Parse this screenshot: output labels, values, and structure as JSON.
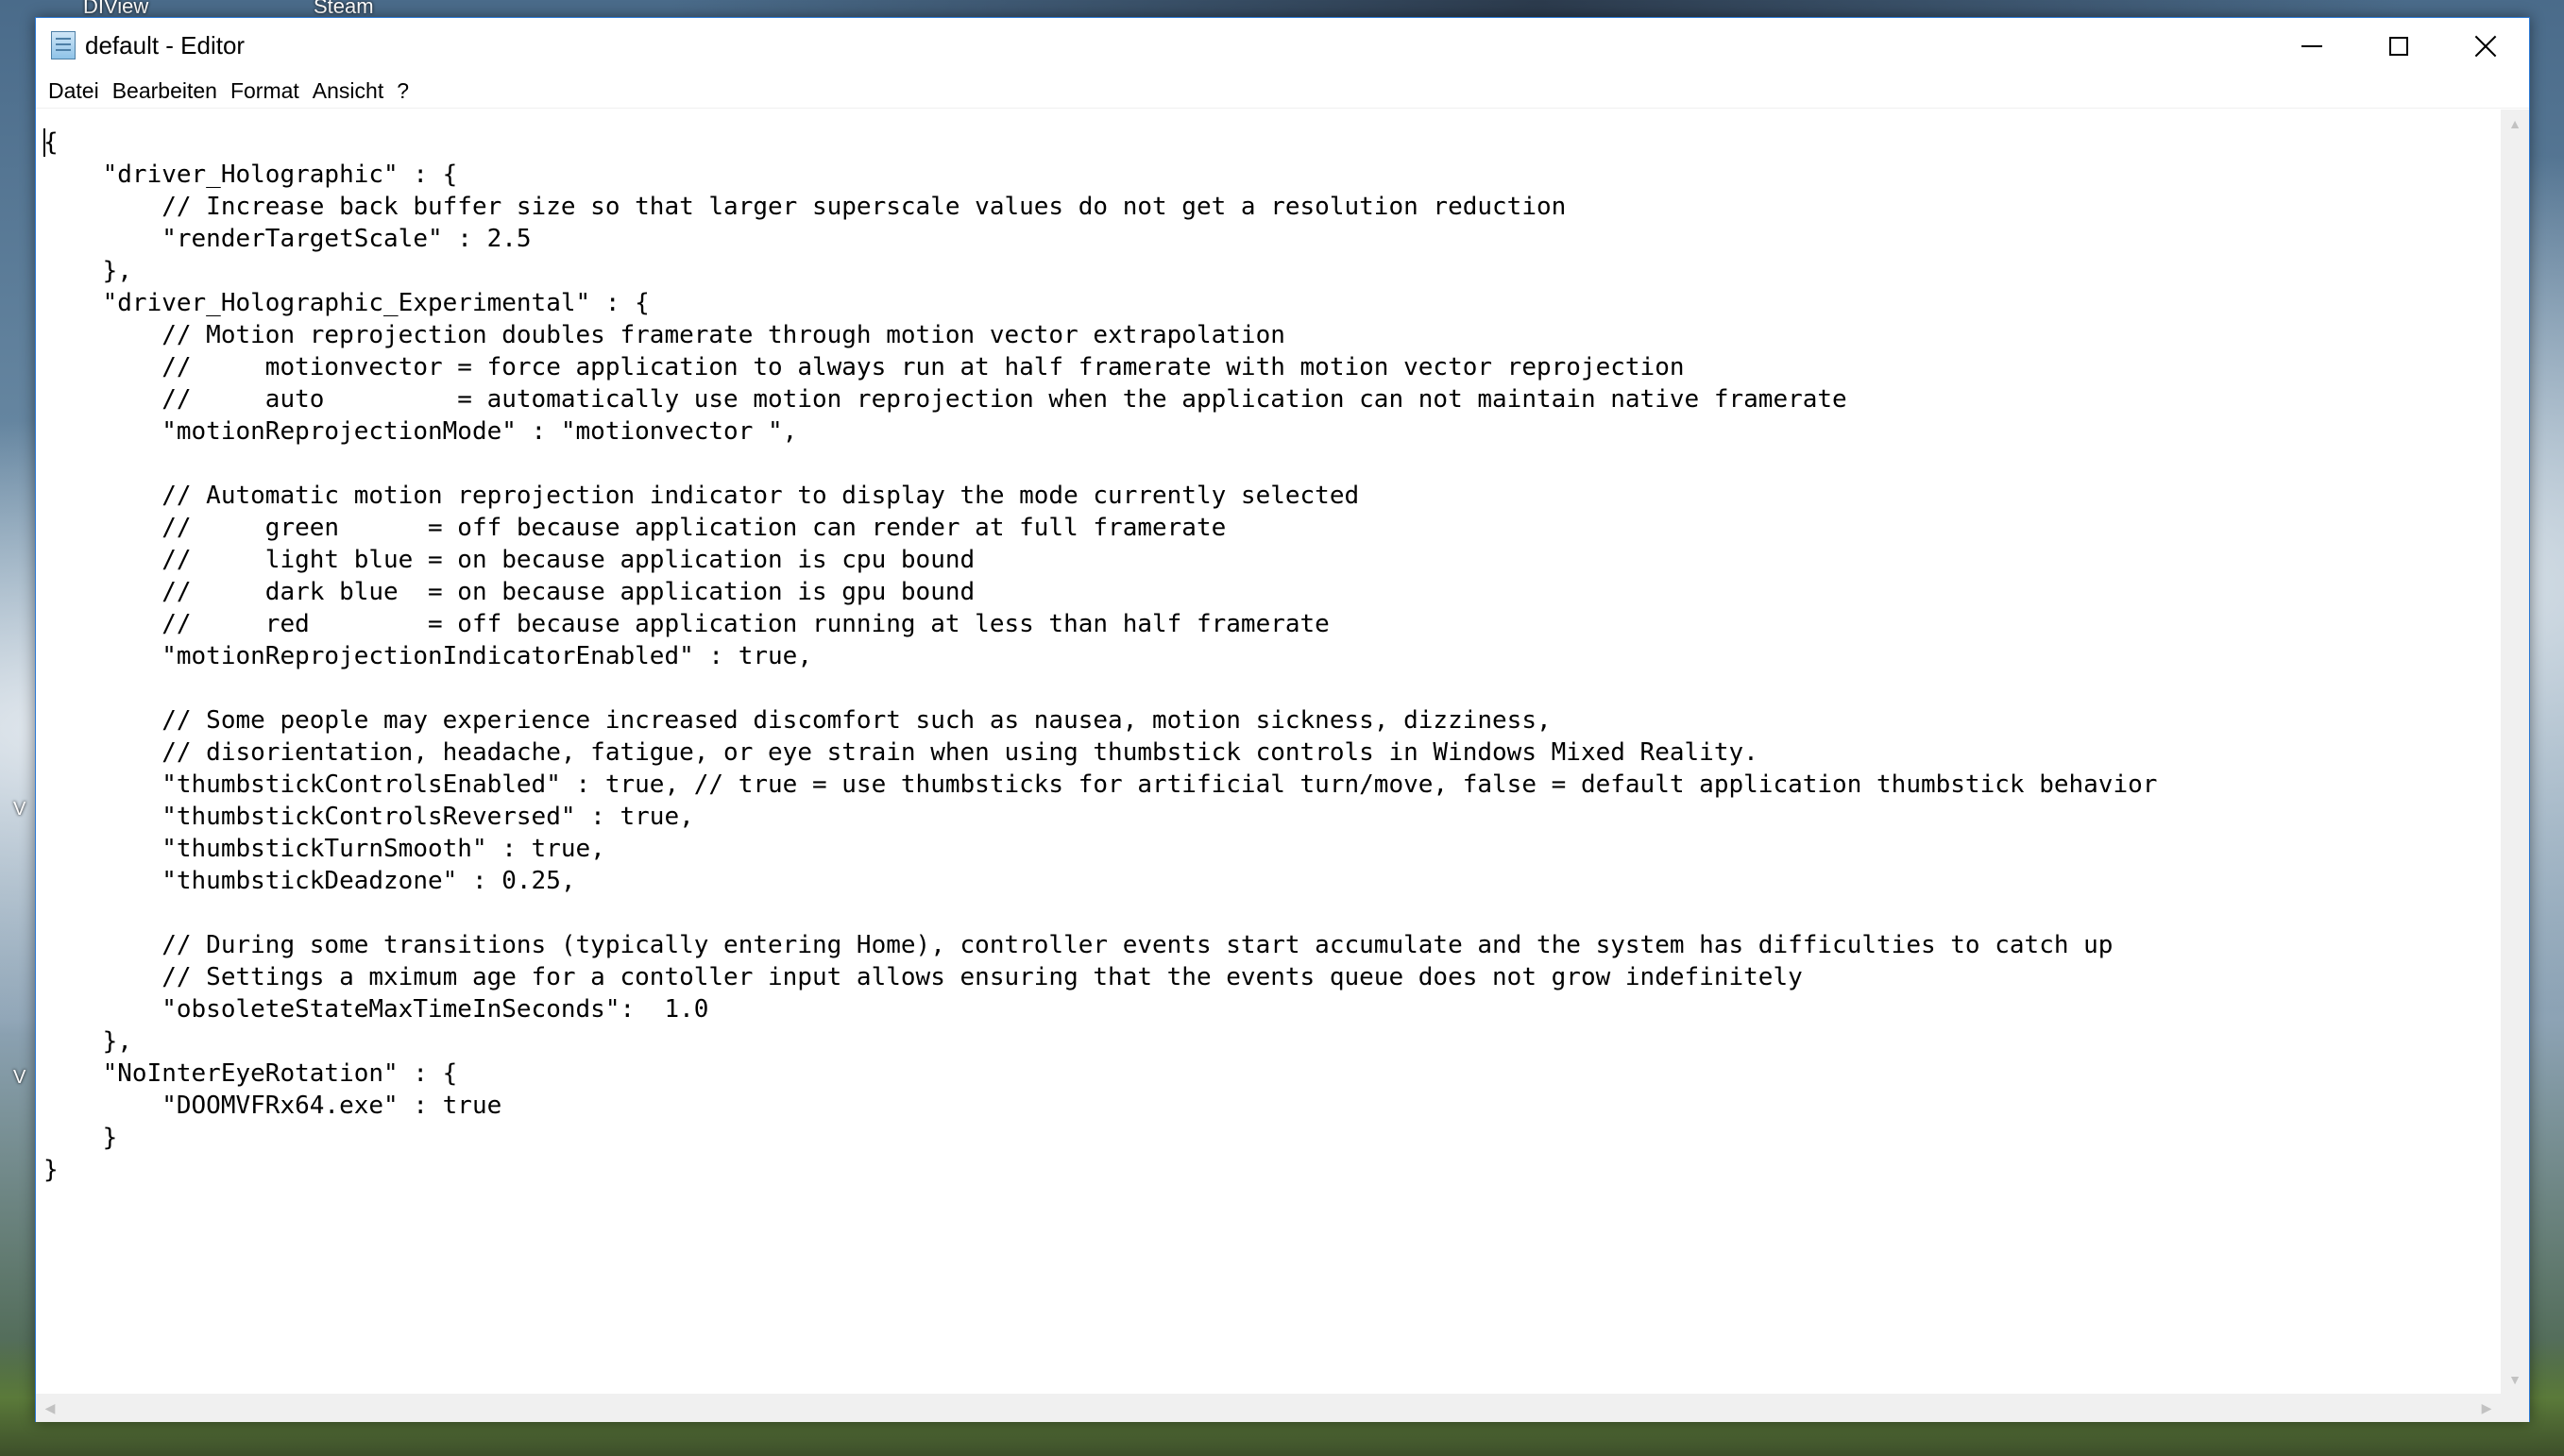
{
  "desktop": {
    "icons": [
      "DIView",
      "Steam",
      "V",
      "V"
    ]
  },
  "window": {
    "title": "default - Editor",
    "icon": "notepad-icon",
    "accent_color": "#2b78d4"
  },
  "controls": {
    "minimize_icon": "minimize-icon",
    "maximize_icon": "maximize-icon",
    "close_icon": "close-icon"
  },
  "menu": {
    "items": [
      {
        "label": "Datei"
      },
      {
        "label": "Bearbeiten"
      },
      {
        "label": "Format"
      },
      {
        "label": "Ansicht"
      },
      {
        "label": "?"
      }
    ]
  },
  "editor": {
    "content": "{\n    \"driver_Holographic\" : {\n        // Increase back buffer size so that larger superscale values do not get a resolution reduction\n        \"renderTargetScale\" : 2.5\n    },\n    \"driver_Holographic_Experimental\" : {\n        // Motion reprojection doubles framerate through motion vector extrapolation\n        //     motionvector = force application to always run at half framerate with motion vector reprojection\n        //     auto         = automatically use motion reprojection when the application can not maintain native framerate\n        \"motionReprojectionMode\" : \"motionvector \",\n\n        // Automatic motion reprojection indicator to display the mode currently selected\n        //     green      = off because application can render at full framerate\n        //     light blue = on because application is cpu bound\n        //     dark blue  = on because application is gpu bound\n        //     red        = off because application running at less than half framerate\n        \"motionReprojectionIndicatorEnabled\" : true,\n\n        // Some people may experience increased discomfort such as nausea, motion sickness, dizziness,\n        // disorientation, headache, fatigue, or eye strain when using thumbstick controls in Windows Mixed Reality.\n        \"thumbstickControlsEnabled\" : true, // true = use thumbsticks for artificial turn/move, false = default application thumbstick behavior\n        \"thumbstickControlsReversed\" : true,\n        \"thumbstickTurnSmooth\" : true,\n        \"thumbstickDeadzone\" : 0.25,\n\n        // During some transitions (typically entering Home), controller events start accumulate and the system has difficulties to catch up\n        // Settings a mximum age for a contoller input allows ensuring that the events queue does not grow indefinitely\n        \"obsoleteStateMaxTimeInSeconds\":  1.0\n    },\n    \"NoInterEyeRotation\" : {\n        \"DOOMVFRx64.exe\" : true\n    }\n}"
  }
}
